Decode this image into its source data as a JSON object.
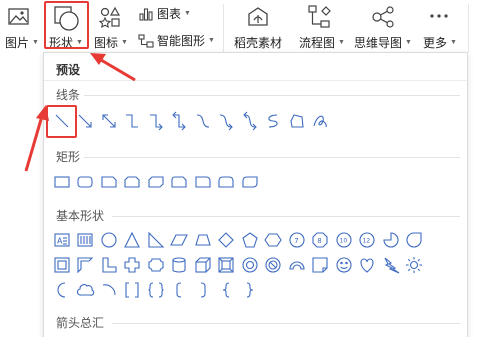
{
  "ribbon": {
    "picture_label": "图片",
    "shape_label": "形状",
    "icon_label": "图标",
    "chart_label": "图表",
    "smartart_label": "智能图形",
    "material_label": "稻壳素材",
    "flowchart_label": "流程图",
    "mindmap_label": "思维导图",
    "more_label": "更多"
  },
  "panel": {
    "preset_title": "预设",
    "sections": {
      "lines": "线条",
      "rectangles": "矩形",
      "basic_shapes": "基本形状",
      "arrows": "箭头总汇"
    }
  },
  "colors": {
    "accent": "#e83a35",
    "shape_stroke": "#3e6bc1"
  },
  "icons": {
    "lines": [
      "line",
      "arrow",
      "double-arrow",
      "elbow-connector",
      "elbow-arrow",
      "elbow-double-arrow",
      "curved-connector",
      "curved-arrow",
      "curved-double-arrow",
      "curve",
      "freeform",
      "scribble"
    ],
    "rectangles": [
      "rectangle",
      "rounded-rectangle",
      "snip-single-corner",
      "snip-same-side",
      "snip-diagonal",
      "snip-round",
      "round-single-corner",
      "round-same-side",
      "round-diagonal"
    ],
    "basic_row1": [
      "text-box",
      "vertical-text-box",
      "oval",
      "triangle",
      "right-triangle",
      "parallelogram",
      "trapezoid",
      "diamond",
      "pentagon",
      "hexagon",
      "heptagon",
      "octagon",
      "decagon",
      "dodecagon",
      "pie",
      "teardrop"
    ],
    "basic_row2": [
      "frame",
      "half-frame",
      "l-shape",
      "cross",
      "plaque",
      "can",
      "cube",
      "bevel",
      "donut",
      "no-symbol",
      "block-arc",
      "folded-corner",
      "smiley-face",
      "heart",
      "lightning-bolt",
      "sun"
    ],
    "basic_row3": [
      "moon",
      "cloud",
      "arc",
      "double-bracket",
      "double-brace",
      "left-bracket",
      "right-bracket",
      "left-brace",
      "right-brace"
    ]
  }
}
